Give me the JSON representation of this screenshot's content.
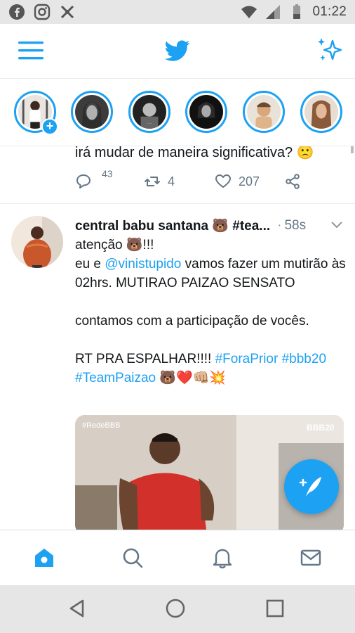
{
  "status_bar": {
    "time": "01:22",
    "icons": [
      "facebook-icon",
      "instagram-icon",
      "app-icon",
      "wifi-icon",
      "signal-icon",
      "battery-icon"
    ]
  },
  "header": {
    "icons": [
      "menu-icon",
      "twitter-bird-icon",
      "sparkle-icon"
    ]
  },
  "fleets": {
    "items": [
      {
        "name": "fleet-own",
        "has_add": true
      },
      {
        "name": "fleet-1"
      },
      {
        "name": "fleet-2"
      },
      {
        "name": "fleet-3"
      },
      {
        "name": "fleet-4"
      },
      {
        "name": "fleet-5"
      }
    ],
    "add_label": "+"
  },
  "previous_tweet": {
    "text": "irá mudar de maneira significativa? 🙁",
    "reply_count": "43",
    "retweet_count": "4",
    "like_count": "207"
  },
  "tweet": {
    "name": "central babu santana 🐻 #tea...",
    "dot": "·",
    "time": "58s",
    "line1": "atenção 🐻!!!",
    "line2_pre": "eu e ",
    "mention": "@vinistupido",
    "line2_post": " vamos fazer um mutirão às 02hrs. MUTIRAO PAIZAO SENSATO",
    "line3": "contamos com a participação de vocês.",
    "line4_pre": "RT PRA ESPALHAR!!!! ",
    "hashtag1": "#ForaPrior",
    "hashtag2": "#bbb20",
    "hashtag3": "#TeamPaizao",
    "line4_emoji": "🐻❤️👊🏼💥",
    "media_watermark_left": "#RedeBBB",
    "media_watermark_right": "BBB20"
  },
  "tabs": [
    "home-tab",
    "search-tab",
    "notifications-tab",
    "messages-tab"
  ],
  "colors": {
    "brand": "#1da1f2",
    "text": "#14171a",
    "muted": "#657786"
  }
}
